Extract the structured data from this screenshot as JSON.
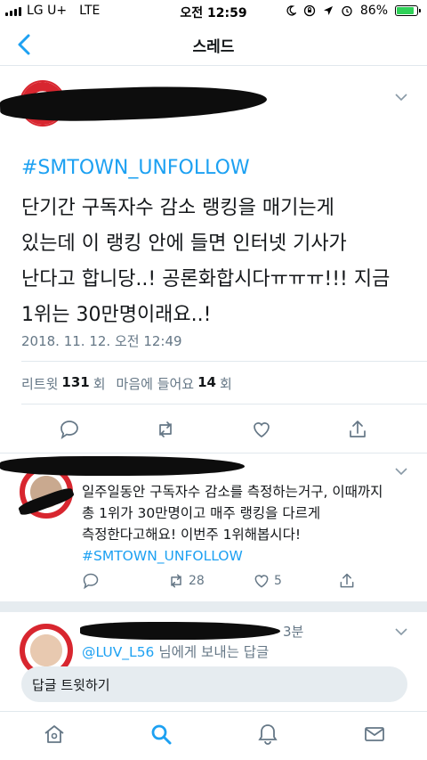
{
  "status_bar": {
    "carrier": "LG U+",
    "network": "LTE",
    "time": "오전 12:59",
    "battery_percent": "86%",
    "battery_level": 0.86
  },
  "nav": {
    "title": "스레드",
    "back_icon": "chevron-left-icon"
  },
  "main_tweet": {
    "hashtag": "#SMTOWN_UNFOLLOW",
    "text_lines": [
      "단기간 구독자수 감소 랭킹을 매기는게",
      "있는데 이 랭킹 안에 들면 인터넷 기사가",
      "난다고 합니당..! 공론화합시다ㅠㅠㅠ!!! 지금",
      "1위는 30만명이래요..!"
    ],
    "timestamp": "2018. 11. 12. 오전 12:49",
    "retweet_label": "리트윗",
    "retweet_count": "131",
    "retweet_unit": "회",
    "like_label": "마음에 들어요",
    "like_count": "14",
    "like_unit": "회"
  },
  "reply": {
    "text_lines": [
      "일주일동안 구독자수 감소를 측정하는거구, 이때까지",
      "총 1위가 30만명이고 매주 랭킹을 다르게",
      "측정한다고해요! 이번주 1위해봅시다!"
    ],
    "hashtag": "#SMTOWN_UNFOLLOW",
    "retweets": "28",
    "likes": "5"
  },
  "next_reply": {
    "time_fragment": "3분",
    "mention": "@LUV_L56",
    "mention_suffix": " 님에게 보내는 답글"
  },
  "compose": {
    "placeholder": "답글 트윗하기"
  },
  "tabs": [
    "home-icon",
    "search-icon",
    "notifications-icon",
    "messages-icon"
  ],
  "colors": {
    "accent": "#1da1f2",
    "text": "#14171a",
    "secondary": "#657786",
    "divider": "#e1e8ed",
    "battery": "#2fd158"
  }
}
